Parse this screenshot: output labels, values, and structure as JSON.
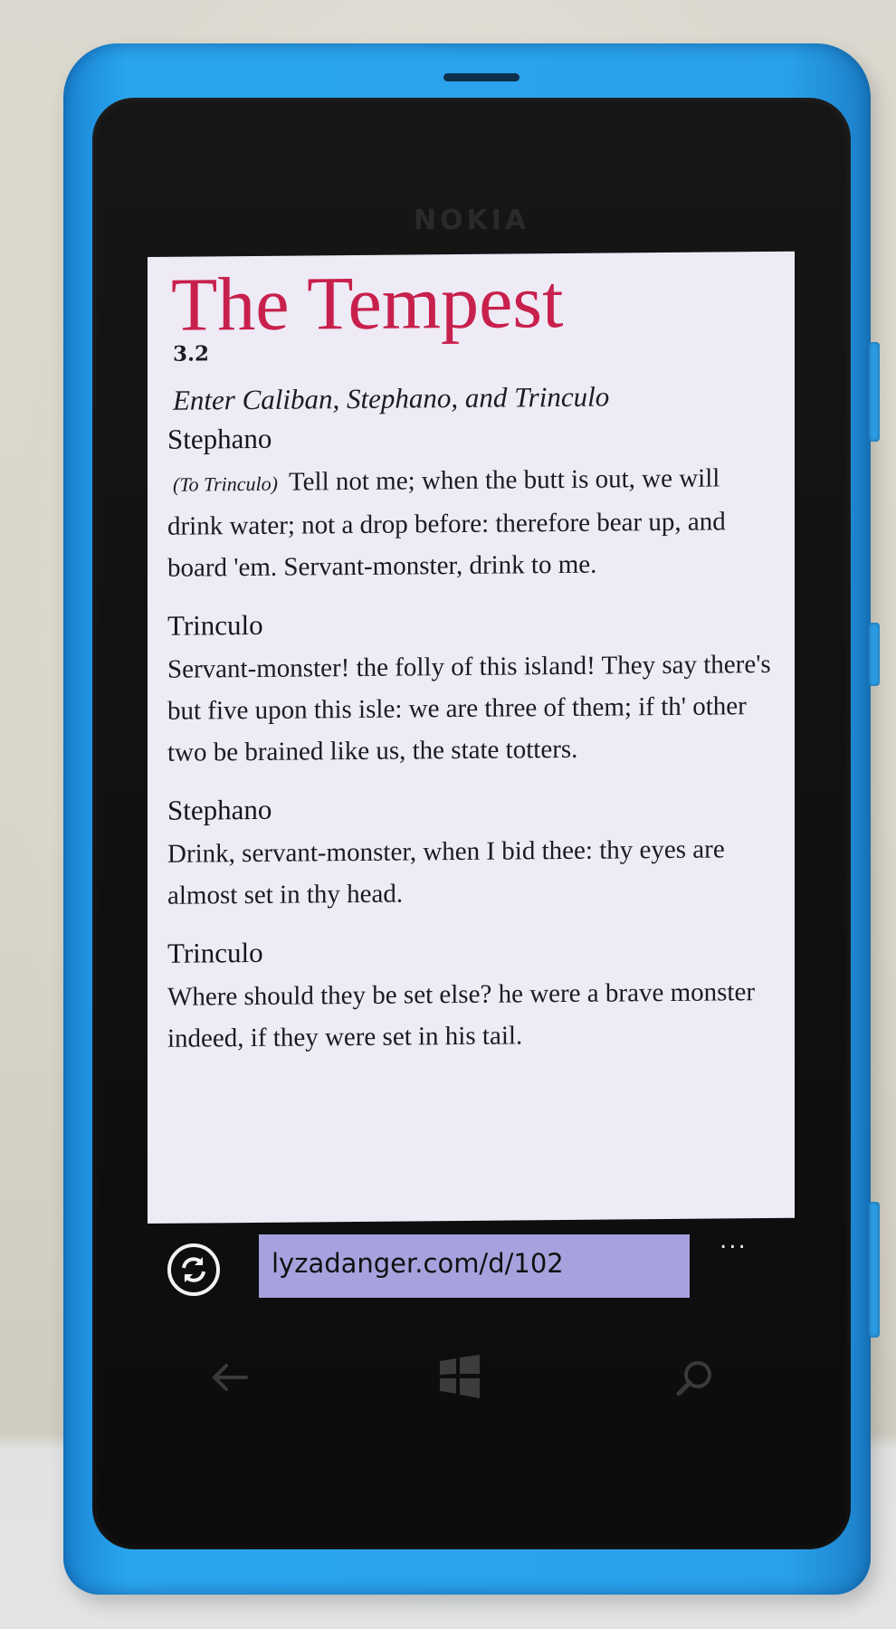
{
  "device": {
    "brand": "NOKIA"
  },
  "page": {
    "title": "The Tempest",
    "scene": "3.2",
    "stage_direction": "Enter Caliban, Stephano, and Trinculo",
    "speeches": [
      {
        "speaker": "Stephano",
        "aside": "(To Trinculo)",
        "text": "Tell not me; when the butt is out, we will drink water; not a drop before: therefore bear up, and board 'em. Servant-monster, drink to me."
      },
      {
        "speaker": "Trinculo",
        "text": "Servant-monster! the folly of this island! They say there's but five upon this isle: we are three of them; if th' other two be brained like us, the state totters."
      },
      {
        "speaker": "Stephano",
        "text": "Drink, servant-monster, when I bid thee: thy eyes are almost set in thy head."
      },
      {
        "speaker": "Trinculo",
        "text": "Where should they be set else? he were a brave monster indeed, if they were set in his tail."
      }
    ]
  },
  "browser": {
    "url": "lyzadanger.com/d/102",
    "more_label": "..."
  },
  "nav": {
    "back_icon": "back-arrow-icon",
    "start_icon": "windows-logo-icon",
    "search_icon": "search-icon"
  }
}
